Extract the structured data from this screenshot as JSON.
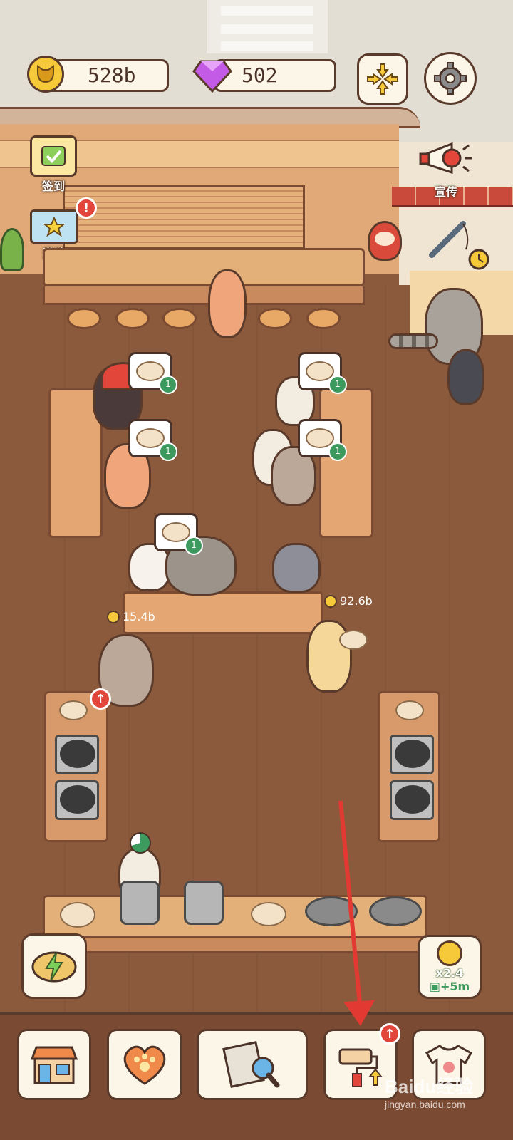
{
  "hud": {
    "coins": "528b",
    "gems": "502",
    "coin_icon": "cat-coin-icon",
    "gem_icon": "purple-gem-icon"
  },
  "side_buttons": {
    "checkin_label": "签到",
    "invite_label": "邀请",
    "invite_alert": "!",
    "promo_label": "宣传"
  },
  "earnings": {
    "left_amount": "15.4b",
    "right_amount": "92.6b"
  },
  "orders": [
    {
      "count": "1"
    },
    {
      "count": "1"
    },
    {
      "count": "1"
    },
    {
      "count": "1"
    },
    {
      "count": "1"
    }
  ],
  "boost": {
    "multiplier": "x2.4",
    "bonus": "+5m"
  },
  "nav": {
    "items": [
      "shop",
      "favorites",
      "news",
      "renovate",
      "outfits"
    ],
    "renovate_badge": "↑"
  },
  "watermark": {
    "brand": "Baidu经验",
    "url": "jingyan.baidu.com"
  },
  "colors": {
    "floor": "#8b5a3c",
    "wood_table": "#e4a774",
    "accent_red": "#e2453a",
    "coin_gold": "#f6c93a",
    "gem_purple": "#b14bd6"
  }
}
